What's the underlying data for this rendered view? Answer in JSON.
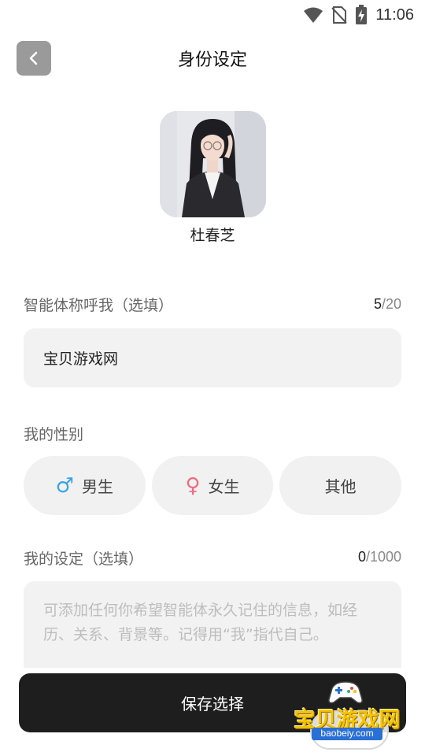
{
  "status_bar": {
    "time": "11:06"
  },
  "header": {
    "title": "身份设定"
  },
  "agent": {
    "name": "杜春芝"
  },
  "nickname": {
    "label": "智能体称呼我（选填）",
    "count_current": "5",
    "count_max": "/20",
    "value": "宝贝游戏网"
  },
  "gender": {
    "label": "我的性别",
    "options": [
      {
        "icon": "♂",
        "label": "男生",
        "color": "#3aa3e8"
      },
      {
        "icon": "♀",
        "label": "女生",
        "color": "#ef6b7f"
      },
      {
        "label": "其他"
      }
    ]
  },
  "setting": {
    "label": "我的设定（选填）",
    "count_current": "0",
    "count_max": "/1000",
    "placeholder": "可添加任何你希望智能体永久记住的信息，如经历、关系、背景等。记得用“我”指代自己。"
  },
  "save_button": {
    "label": "保存选择"
  },
  "watermark": {
    "text": "宝贝游戏网",
    "url": "baobeiy.com"
  }
}
